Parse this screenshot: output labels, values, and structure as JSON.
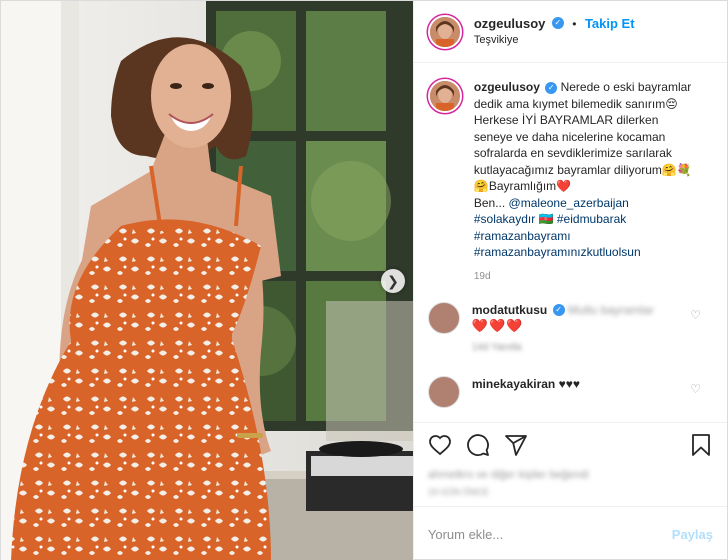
{
  "header": {
    "username": "ozgeulusoy",
    "separator": "•",
    "follow_label": "Takip Et",
    "location": "Teşvikiye"
  },
  "caption": {
    "username": "ozgeulusoy",
    "text_1": "Nerede o eski bayramlar dedik ama kıymet bilemedik sanırım",
    "emoji_1": "😔",
    "text_2": "Herkese İYİ BAYRAMLAR dilerken seneye ve daha nicelerine kocaman sofralarda en sevdiklerimize sarılarak kutlayacağımız bayramlar diliyorum",
    "emoji_2": "🤗💐🤗",
    "text_3": "Bayramlığım",
    "emoji_3": "❤️",
    "text_4": "Ben... ",
    "mention": "@maleone_azerbaijan",
    "tags": [
      "#solakaydır",
      "#eidmubarak",
      "#ramazanbayramı",
      "#ramazanbayramınızkutluolsun"
    ],
    "tag_flag": "🇦🇿",
    "ago": "19d"
  },
  "comments": [
    {
      "username": "modatutkusu",
      "text": "Mutlu bayramlar",
      "hearts": "❤️❤️❤️",
      "meta": "14d   Yanıtla"
    },
    {
      "username": "minekayakiran",
      "text": "",
      "hearts": "♥♥♥"
    }
  ],
  "likes_text": "ahmetkrs ve diğer kişiler beğendi",
  "time_text": "19 GÜN ÖNCE",
  "add_comment": {
    "placeholder": "Yorum ekle...",
    "post_label": "Paylaş"
  },
  "colors": {
    "accent": "#0095f6",
    "heart": "#ed4956",
    "dress": "#d9642a"
  },
  "icons": [
    "next-arrow-icon",
    "verified-badge-icon",
    "heart-icon",
    "comment-icon",
    "share-icon",
    "bookmark-icon"
  ]
}
